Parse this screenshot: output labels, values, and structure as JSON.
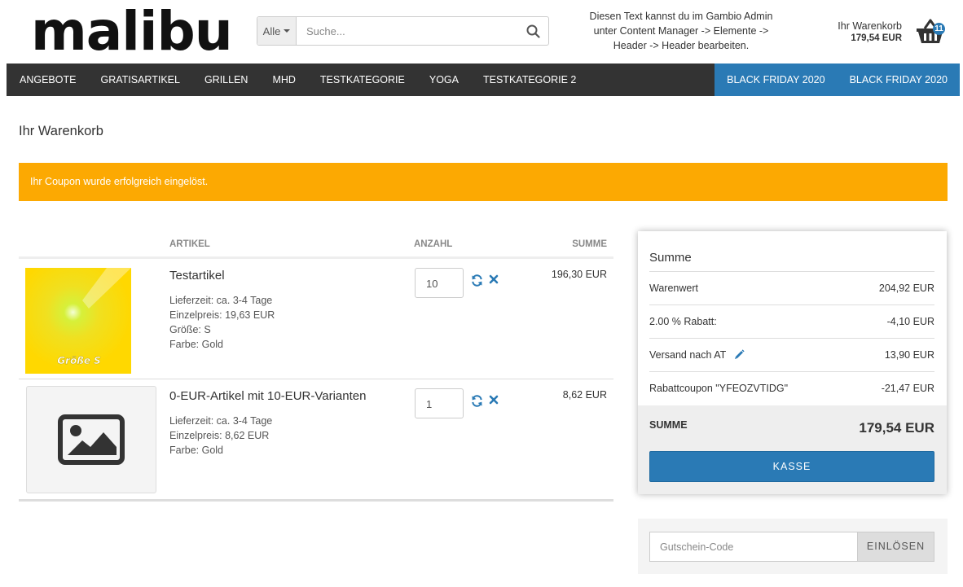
{
  "header": {
    "logo_text": "malibu",
    "search": {
      "category": "Alle",
      "placeholder": "Suche..."
    },
    "info_text_line1": "Diesen Text kannst du im Gambio Admin",
    "info_text_line2": "unter Content Manager -> Elemente ->",
    "info_text_line3": "Header -> Header bearbeiten.",
    "cart_label": "Ihr Warenkorb",
    "cart_amount": "179,54 EUR",
    "cart_count": "11"
  },
  "nav": {
    "items": [
      {
        "label": "ANGEBOTE"
      },
      {
        "label": "GRATISARTIKEL"
      },
      {
        "label": "GRILLEN"
      },
      {
        "label": "MHD"
      },
      {
        "label": "TESTKATEGORIE"
      },
      {
        "label": "YOGA"
      },
      {
        "label": "TESTKATEGORIE 2"
      }
    ],
    "highlight_items": [
      {
        "label": "BLACK FRIDAY 2020"
      },
      {
        "label": "BLACK FRIDAY 2020"
      }
    ]
  },
  "page_title": "Ihr Warenkorb",
  "alert": "Ihr Coupon wurde erfolgreich eingelöst.",
  "cart": {
    "headers": {
      "artikel": "ARTIKEL",
      "anzahl": "ANZAHL",
      "summe": "SUMME"
    },
    "items": [
      {
        "name": "Testartikel",
        "image_caption": "Größe S",
        "lieferzeit": "Lieferzeit: ca. 3-4 Tage",
        "einzelpreis": "Einzelpreis: 19,63 EUR",
        "groesse": "Größe: S",
        "farbe": "Farbe: Gold",
        "quantity": "10",
        "sum": "196,30 EUR"
      },
      {
        "name": "0-EUR-Artikel mit 10-EUR-Varianten",
        "lieferzeit": "Lieferzeit: ca. 3-4 Tage",
        "einzelpreis": "Einzelpreis: 8,62 EUR",
        "farbe": "Farbe: Gold",
        "quantity": "1",
        "sum": "8,62 EUR"
      }
    ]
  },
  "summary": {
    "title": "Summe",
    "rows": [
      {
        "label": "Warenwert",
        "value": "204,92 EUR"
      },
      {
        "label": "2.00 % Rabatt:",
        "value": "-4,10 EUR"
      },
      {
        "label": "Versand nach AT",
        "value": "13,90 EUR"
      },
      {
        "label": "Rabattcoupon \"YFEOZVTIDG\"",
        "value": "-21,47 EUR"
      }
    ],
    "total_label": "SUMME",
    "total_value": "179,54 EUR",
    "checkout_label": "KASSE"
  },
  "coupon": {
    "placeholder": "Gutschein-Code",
    "button_label": "EINLÖSEN"
  },
  "colors": {
    "nav_bg": "#333333",
    "accent_blue": "#2a7ab5",
    "alert_orange": "#fca902"
  }
}
